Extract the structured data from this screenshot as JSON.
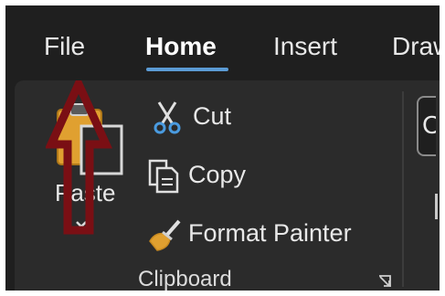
{
  "tabs": [
    {
      "label": "File",
      "active": false
    },
    {
      "label": "Home",
      "active": true
    },
    {
      "label": "Insert",
      "active": false
    },
    {
      "label": "Draw",
      "active": false
    }
  ],
  "clipboard": {
    "paste_label": "Paste",
    "cut_label": "Cut",
    "copy_label": "Copy",
    "format_painter_label": "Format Painter",
    "group_label": "Clipboard"
  },
  "next_group": {
    "visible_text": "C"
  },
  "colors": {
    "background": "#1f1f1f",
    "ribbon": "#2b2b2b",
    "accent": "#5b9bd5",
    "annotation_arrow": "#7a0f14"
  },
  "icons": {
    "paste": "paste-icon",
    "cut": "scissors-icon",
    "copy": "copy-icon",
    "format_painter": "paintbrush-icon",
    "expand": "chevron-down-icon",
    "launcher": "dialog-launcher-icon",
    "annotation": "up-arrow-icon"
  }
}
